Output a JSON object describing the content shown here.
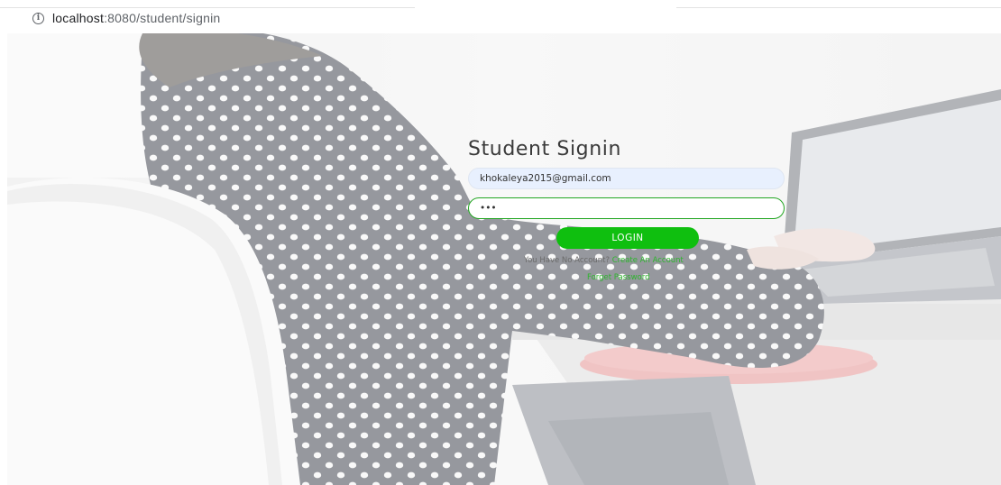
{
  "browser": {
    "url_host": "localhost",
    "url_path": ":8080/student/signin",
    "info_icon": "info-icon"
  },
  "form": {
    "title": "Student Signin",
    "email_value": "khokaleya2015@gmail.com",
    "password_value": "•••",
    "login_label": "LOGIN",
    "no_account_text": "You Have No Account?",
    "create_account_label": "Create An Account",
    "forget_password_label": "Forget Password"
  },
  "colors": {
    "accent_green": "#0fbf0f",
    "link_green": "#2cb52c",
    "input_focus_border": "#22a622"
  }
}
